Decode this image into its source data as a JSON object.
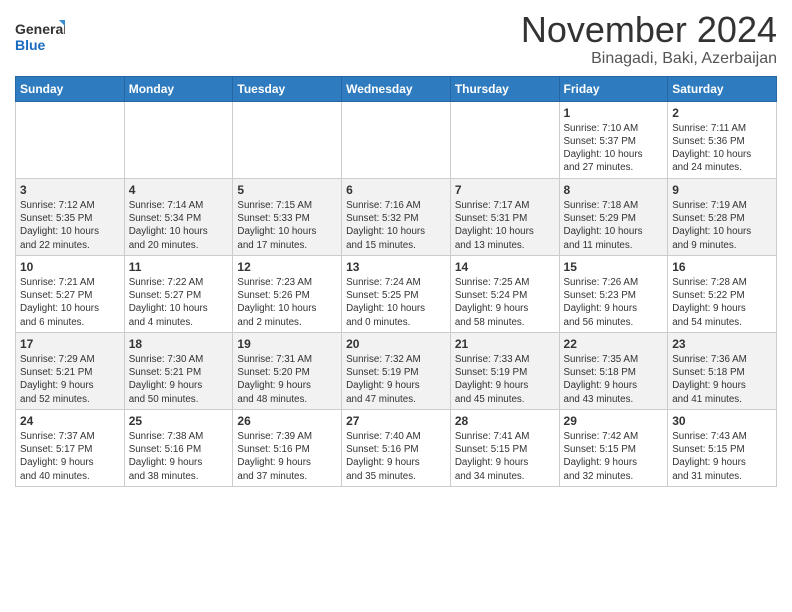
{
  "logo": {
    "text_general": "General",
    "text_blue": "Blue"
  },
  "header": {
    "month": "November 2024",
    "location": "Binagadi, Baki, Azerbaijan"
  },
  "weekdays": [
    "Sunday",
    "Monday",
    "Tuesday",
    "Wednesday",
    "Thursday",
    "Friday",
    "Saturday"
  ],
  "weeks": [
    [
      {
        "day": "",
        "info": ""
      },
      {
        "day": "",
        "info": ""
      },
      {
        "day": "",
        "info": ""
      },
      {
        "day": "",
        "info": ""
      },
      {
        "day": "",
        "info": ""
      },
      {
        "day": "1",
        "info": "Sunrise: 7:10 AM\nSunset: 5:37 PM\nDaylight: 10 hours\nand 27 minutes."
      },
      {
        "day": "2",
        "info": "Sunrise: 7:11 AM\nSunset: 5:36 PM\nDaylight: 10 hours\nand 24 minutes."
      }
    ],
    [
      {
        "day": "3",
        "info": "Sunrise: 7:12 AM\nSunset: 5:35 PM\nDaylight: 10 hours\nand 22 minutes."
      },
      {
        "day": "4",
        "info": "Sunrise: 7:14 AM\nSunset: 5:34 PM\nDaylight: 10 hours\nand 20 minutes."
      },
      {
        "day": "5",
        "info": "Sunrise: 7:15 AM\nSunset: 5:33 PM\nDaylight: 10 hours\nand 17 minutes."
      },
      {
        "day": "6",
        "info": "Sunrise: 7:16 AM\nSunset: 5:32 PM\nDaylight: 10 hours\nand 15 minutes."
      },
      {
        "day": "7",
        "info": "Sunrise: 7:17 AM\nSunset: 5:31 PM\nDaylight: 10 hours\nand 13 minutes."
      },
      {
        "day": "8",
        "info": "Sunrise: 7:18 AM\nSunset: 5:29 PM\nDaylight: 10 hours\nand 11 minutes."
      },
      {
        "day": "9",
        "info": "Sunrise: 7:19 AM\nSunset: 5:28 PM\nDaylight: 10 hours\nand 9 minutes."
      }
    ],
    [
      {
        "day": "10",
        "info": "Sunrise: 7:21 AM\nSunset: 5:27 PM\nDaylight: 10 hours\nand 6 minutes."
      },
      {
        "day": "11",
        "info": "Sunrise: 7:22 AM\nSunset: 5:27 PM\nDaylight: 10 hours\nand 4 minutes."
      },
      {
        "day": "12",
        "info": "Sunrise: 7:23 AM\nSunset: 5:26 PM\nDaylight: 10 hours\nand 2 minutes."
      },
      {
        "day": "13",
        "info": "Sunrise: 7:24 AM\nSunset: 5:25 PM\nDaylight: 10 hours\nand 0 minutes."
      },
      {
        "day": "14",
        "info": "Sunrise: 7:25 AM\nSunset: 5:24 PM\nDaylight: 9 hours\nand 58 minutes."
      },
      {
        "day": "15",
        "info": "Sunrise: 7:26 AM\nSunset: 5:23 PM\nDaylight: 9 hours\nand 56 minutes."
      },
      {
        "day": "16",
        "info": "Sunrise: 7:28 AM\nSunset: 5:22 PM\nDaylight: 9 hours\nand 54 minutes."
      }
    ],
    [
      {
        "day": "17",
        "info": "Sunrise: 7:29 AM\nSunset: 5:21 PM\nDaylight: 9 hours\nand 52 minutes."
      },
      {
        "day": "18",
        "info": "Sunrise: 7:30 AM\nSunset: 5:21 PM\nDaylight: 9 hours\nand 50 minutes."
      },
      {
        "day": "19",
        "info": "Sunrise: 7:31 AM\nSunset: 5:20 PM\nDaylight: 9 hours\nand 48 minutes."
      },
      {
        "day": "20",
        "info": "Sunrise: 7:32 AM\nSunset: 5:19 PM\nDaylight: 9 hours\nand 47 minutes."
      },
      {
        "day": "21",
        "info": "Sunrise: 7:33 AM\nSunset: 5:19 PM\nDaylight: 9 hours\nand 45 minutes."
      },
      {
        "day": "22",
        "info": "Sunrise: 7:35 AM\nSunset: 5:18 PM\nDaylight: 9 hours\nand 43 minutes."
      },
      {
        "day": "23",
        "info": "Sunrise: 7:36 AM\nSunset: 5:18 PM\nDaylight: 9 hours\nand 41 minutes."
      }
    ],
    [
      {
        "day": "24",
        "info": "Sunrise: 7:37 AM\nSunset: 5:17 PM\nDaylight: 9 hours\nand 40 minutes."
      },
      {
        "day": "25",
        "info": "Sunrise: 7:38 AM\nSunset: 5:16 PM\nDaylight: 9 hours\nand 38 minutes."
      },
      {
        "day": "26",
        "info": "Sunrise: 7:39 AM\nSunset: 5:16 PM\nDaylight: 9 hours\nand 37 minutes."
      },
      {
        "day": "27",
        "info": "Sunrise: 7:40 AM\nSunset: 5:16 PM\nDaylight: 9 hours\nand 35 minutes."
      },
      {
        "day": "28",
        "info": "Sunrise: 7:41 AM\nSunset: 5:15 PM\nDaylight: 9 hours\nand 34 minutes."
      },
      {
        "day": "29",
        "info": "Sunrise: 7:42 AM\nSunset: 5:15 PM\nDaylight: 9 hours\nand 32 minutes."
      },
      {
        "day": "30",
        "info": "Sunrise: 7:43 AM\nSunset: 5:15 PM\nDaylight: 9 hours\nand 31 minutes."
      }
    ]
  ]
}
